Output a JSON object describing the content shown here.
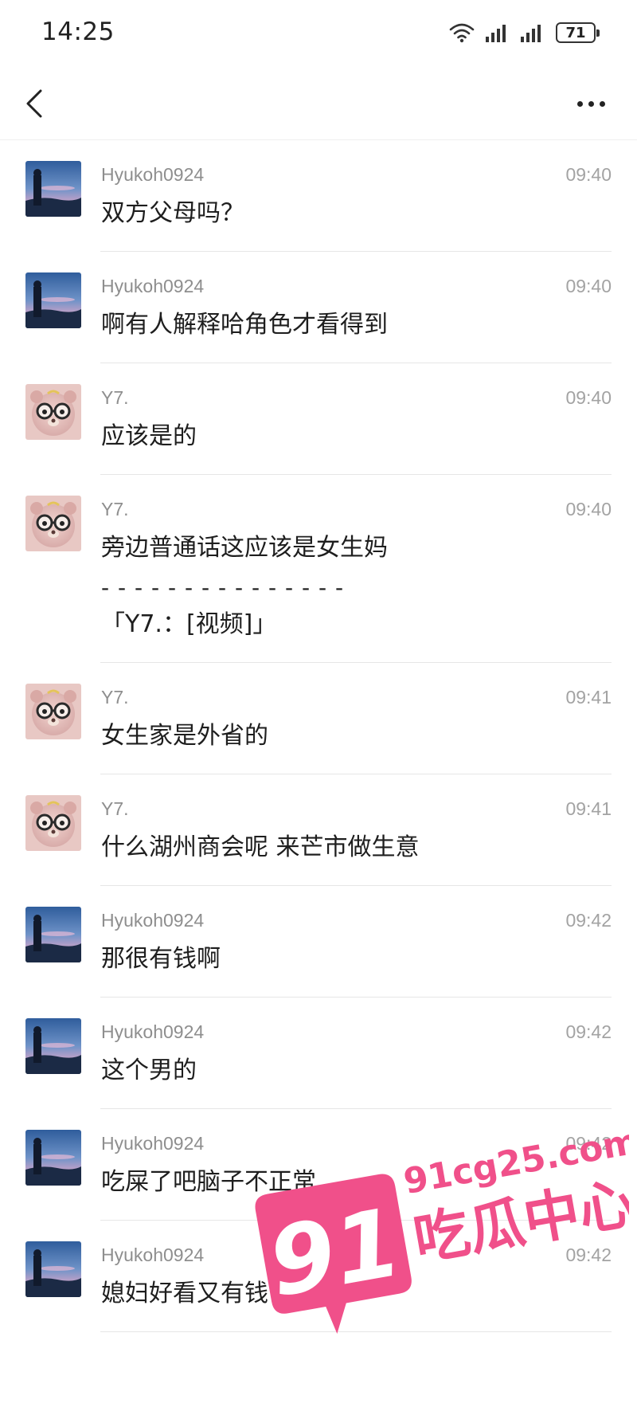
{
  "status_bar": {
    "time": "14:25",
    "battery": "71"
  },
  "messages": [
    {
      "sender": "Hyukoh0924",
      "time": "09:40",
      "text": "双方父母吗？",
      "avatar": "landscape"
    },
    {
      "sender": "Hyukoh0924",
      "time": "09:40",
      "text": "啊有人解释哈角色才看得到",
      "avatar": "landscape"
    },
    {
      "sender": "Y7.",
      "time": "09:40",
      "text": "应该是的",
      "avatar": "bear"
    },
    {
      "sender": "Y7.",
      "time": "09:40",
      "text": "旁边普通话这应该是女生妈",
      "divider": "- - - - - - - - - - - - - - -",
      "quote": "「Y7.：[视频]」",
      "avatar": "bear"
    },
    {
      "sender": "Y7.",
      "time": "09:41",
      "text": "女生家是外省的",
      "avatar": "bear"
    },
    {
      "sender": "Y7.",
      "time": "09:41",
      "text": "什么湖州商会呢 来芒市做生意",
      "avatar": "bear"
    },
    {
      "sender": "Hyukoh0924",
      "time": "09:42",
      "text": "那很有钱啊",
      "avatar": "landscape"
    },
    {
      "sender": "Hyukoh0924",
      "time": "09:42",
      "text": "这个男的",
      "avatar": "landscape"
    },
    {
      "sender": "Hyukoh0924",
      "time": "09:42",
      "text": "吃屎了吧脑子不正常",
      "avatar": "landscape"
    },
    {
      "sender": "Hyukoh0924",
      "time": "09:42",
      "text": "媳妇好看又有钱",
      "avatar": "landscape"
    }
  ],
  "watermark": {
    "number": "91",
    "url": "91cg25.com",
    "name": "吃瓜中心"
  },
  "colors": {
    "watermark_pink": "#f0508a",
    "separator": "#e6e6e6"
  }
}
